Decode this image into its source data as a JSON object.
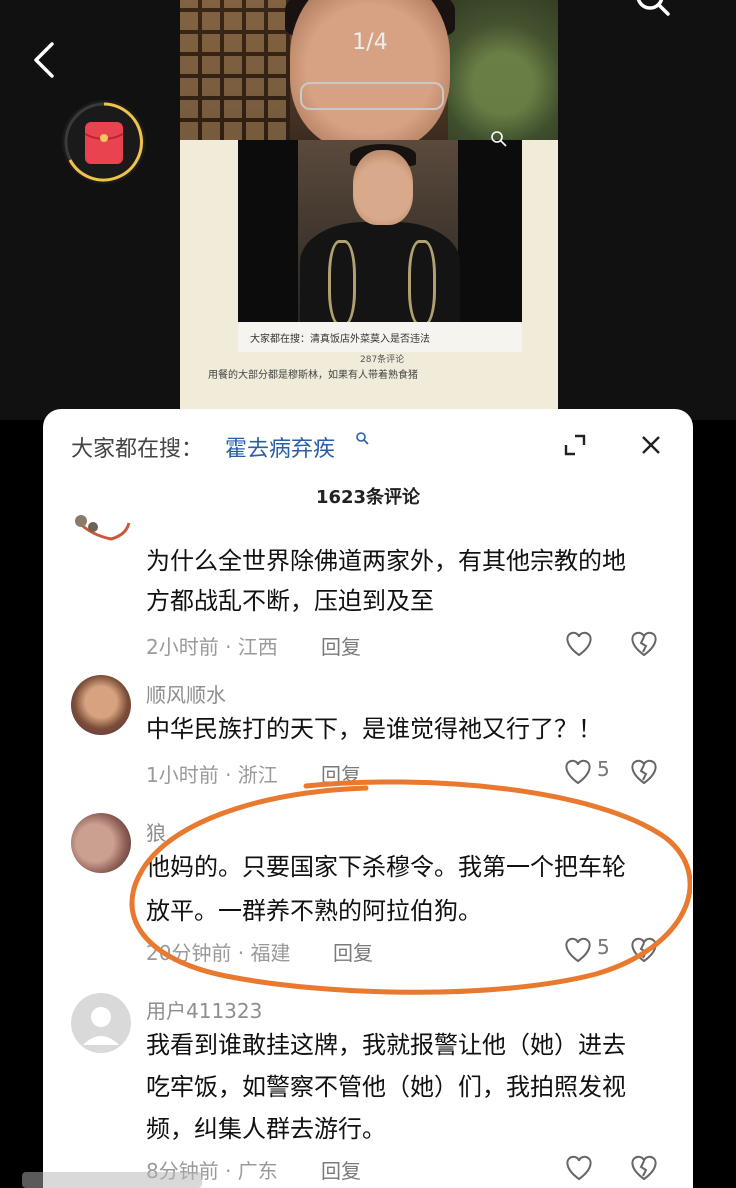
{
  "header": {
    "page_counter": "1/4"
  },
  "mini_screenshot": {
    "search_text": "大家都在搜：清真饭店外菜莫入是否违法",
    "count": "287条评论",
    "body_text": "用餐的大部分都是穆斯林，如果有人带着熟食猪"
  },
  "comments_sheet": {
    "search_prefix": "大家都在搜：",
    "search_term": "霍去病弃疾",
    "count": "1623条评论",
    "reply_label": "回复",
    "comments": [
      {
        "text_line1": "为什么全世界除佛道两家外，有其他宗教的地",
        "text_line2": "方都战乱不断，压迫到及至",
        "meta": "2小时前 · 江西",
        "likes": ""
      },
      {
        "user": "顺风顺水",
        "text_line1": "中华民族打的天下，是谁觉得祂又行了？！",
        "meta": "1小时前 · 浙江",
        "likes": "5"
      },
      {
        "user": "狼",
        "text_line1": "他妈的。只要国家下杀穆令。我第一个把车轮",
        "text_line2": "放平。一群养不熟的阿拉伯狗。",
        "meta": "20分钟前 · 福建",
        "likes": "5"
      },
      {
        "user": "用户411323",
        "text_line1": "我看到谁敢挂这牌，我就报警让他（她）进去",
        "text_line2": "吃牢饭，如警察不管他（她）们，我拍照发视",
        "text_line3": "频，纠集人群去游行。",
        "meta": "8分钟前 · 广东",
        "likes": ""
      }
    ]
  },
  "colors": {
    "search_link": "#2a5fa8",
    "annotation": "#e8792e",
    "redpacket": "#e8434f"
  }
}
